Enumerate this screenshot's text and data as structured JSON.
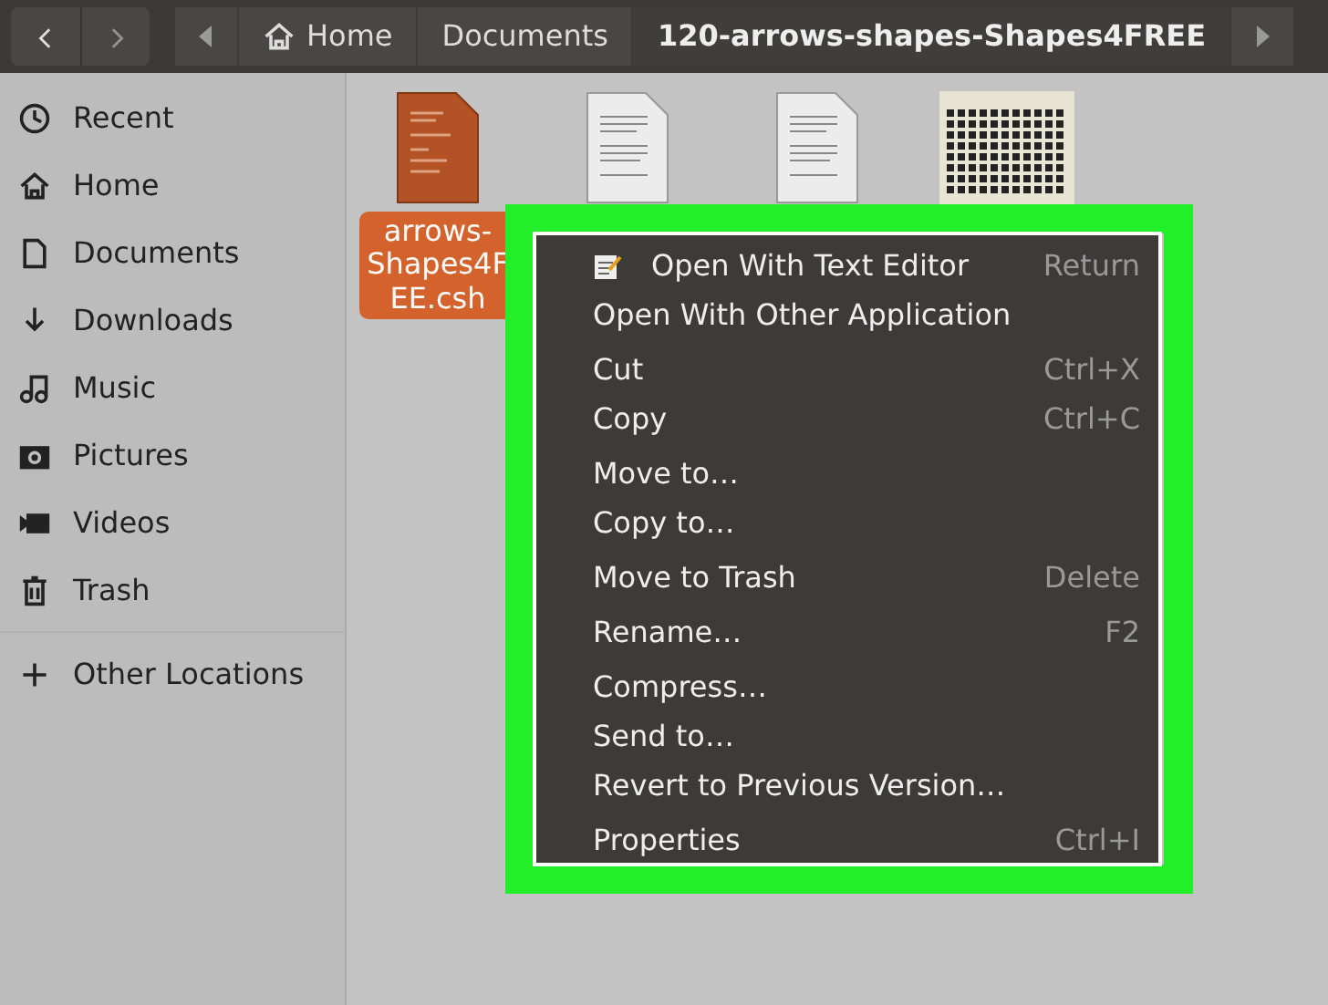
{
  "header": {
    "breadcrumbs": [
      {
        "label": "Home",
        "kind": "home",
        "selected": false
      },
      {
        "label": "Documents",
        "kind": "plain",
        "selected": false
      },
      {
        "label": "120-arrows-shapes-Shapes4FREE",
        "kind": "plain",
        "selected": true
      }
    ]
  },
  "sidebar": {
    "items": [
      {
        "label": "Recent",
        "kind": "recent"
      },
      {
        "label": "Home",
        "kind": "home"
      },
      {
        "label": "Documents",
        "kind": "document"
      },
      {
        "label": "Downloads",
        "kind": "download"
      },
      {
        "label": "Music",
        "kind": "music"
      },
      {
        "label": "Pictures",
        "kind": "camera"
      },
      {
        "label": "Videos",
        "kind": "video"
      },
      {
        "label": "Trash",
        "kind": "trash"
      }
    ],
    "other": {
      "label": "Other Locations"
    }
  },
  "files": [
    {
      "kind": "orange-doc",
      "selected": true,
      "label_lines": [
        "arrows-",
        "Shapes4F",
        "EE.csh"
      ]
    },
    {
      "kind": "text-doc",
      "selected": false
    },
    {
      "kind": "text-doc",
      "selected": false
    },
    {
      "kind": "image",
      "selected": false
    }
  ],
  "context_menu": {
    "groups": [
      [
        {
          "label": "Open With Text Editor",
          "shortcut": "Return",
          "icon": true
        },
        {
          "label": "Open With Other Application"
        }
      ],
      [
        {
          "label": "Cut",
          "shortcut": "Ctrl+X"
        },
        {
          "label": "Copy",
          "shortcut": "Ctrl+C"
        }
      ],
      [
        {
          "label": "Move to…"
        },
        {
          "label": "Copy to…"
        }
      ],
      [
        {
          "label": "Move to Trash",
          "shortcut": "Delete"
        }
      ],
      [
        {
          "label": "Rename…",
          "shortcut": "F2"
        }
      ],
      [
        {
          "label": "Compress…"
        },
        {
          "label": "Send to…"
        },
        {
          "label": "Revert to Previous Version…"
        }
      ],
      [
        {
          "label": "Properties",
          "shortcut": "Ctrl+I"
        }
      ]
    ]
  }
}
